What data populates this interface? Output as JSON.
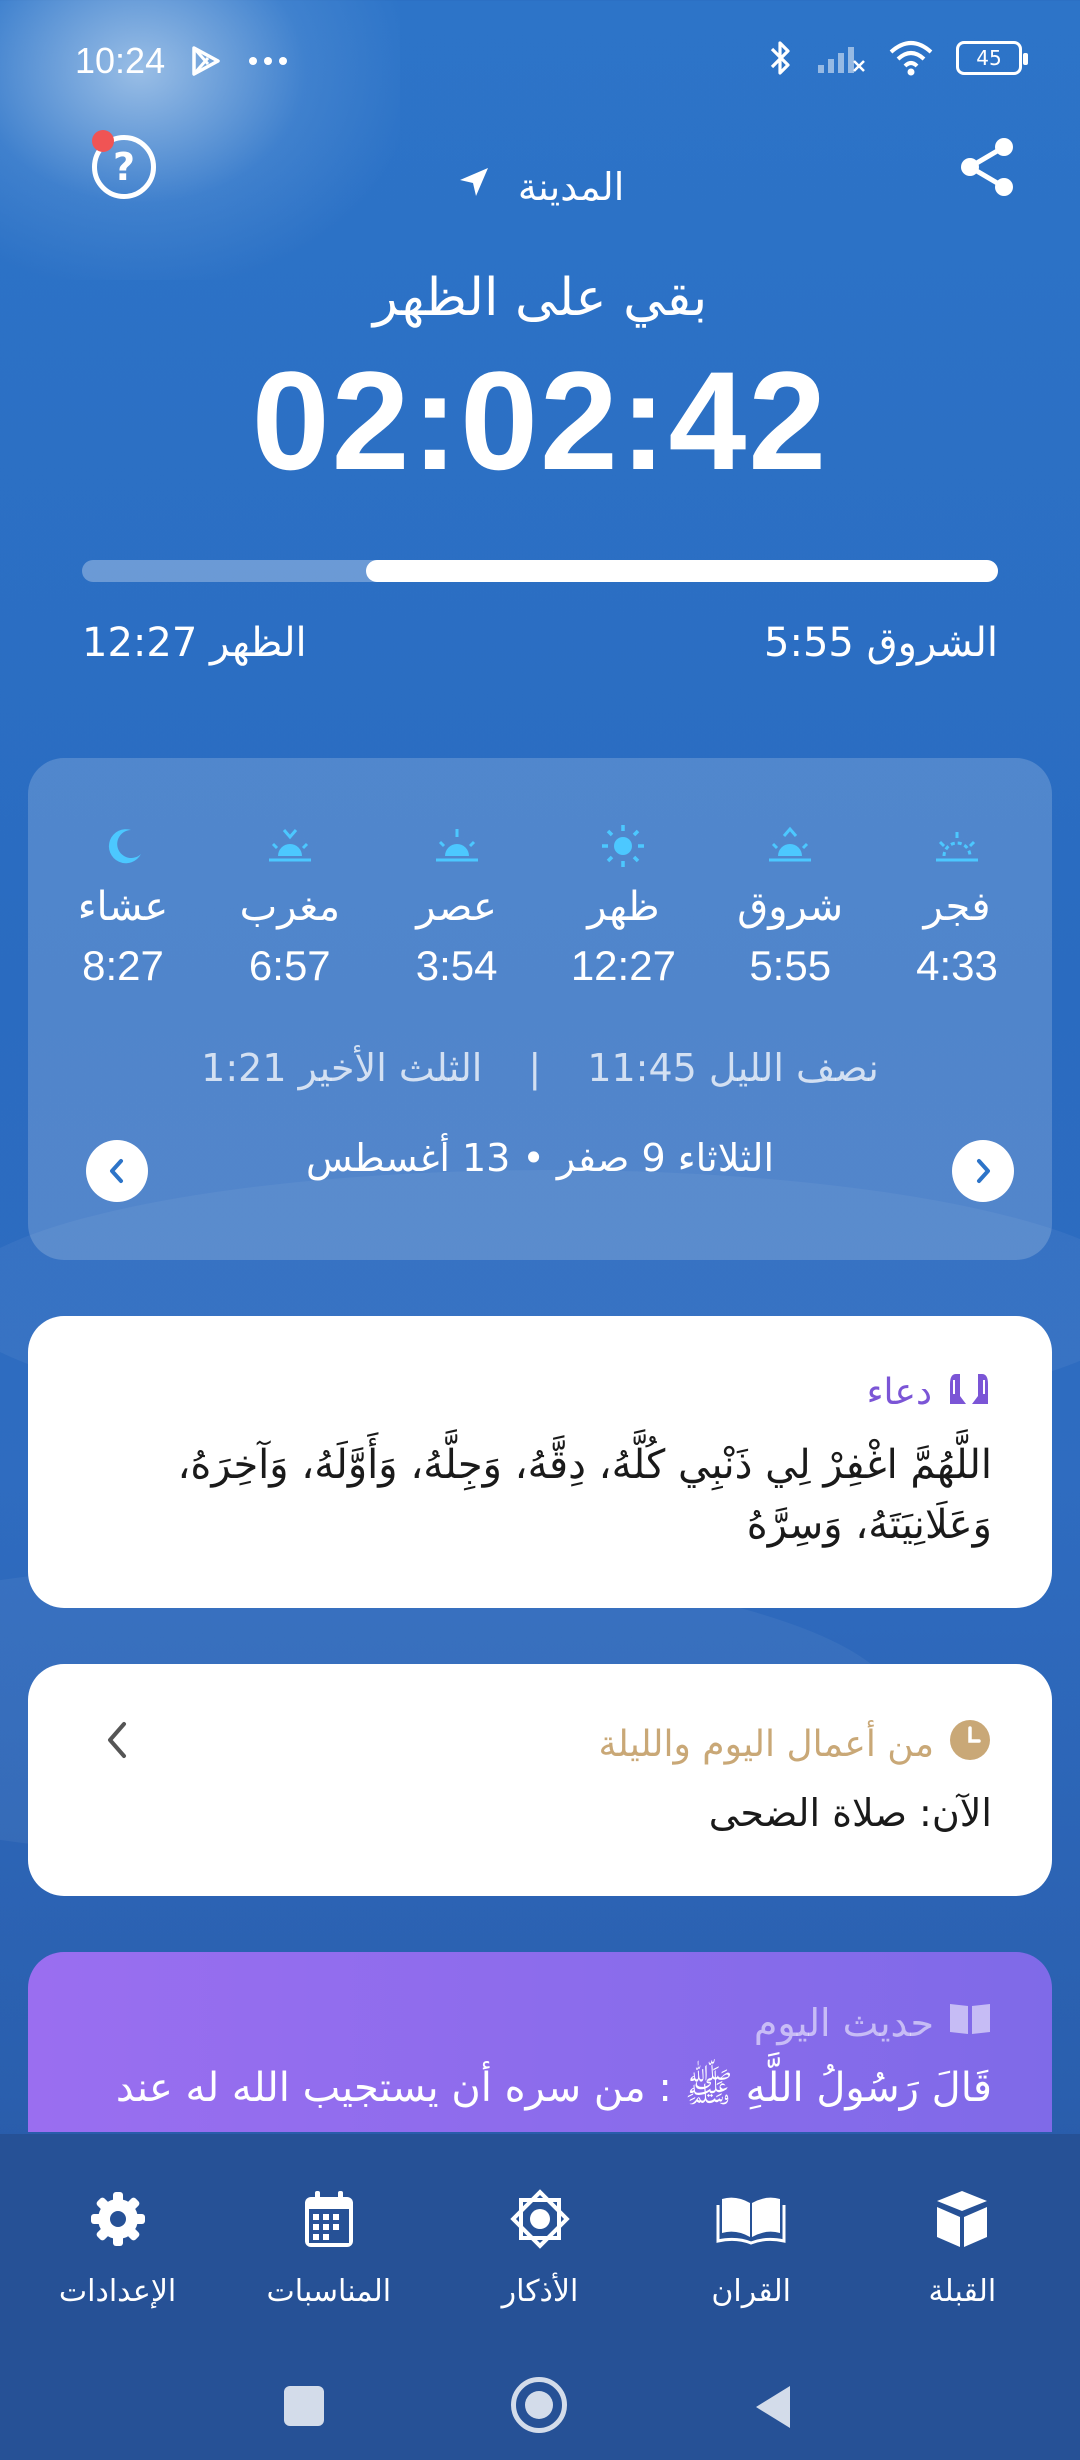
{
  "status_bar": {
    "time": "10:24",
    "battery": "45"
  },
  "header": {
    "city": "المدينة",
    "remaining_label": "بقي على الظهر",
    "countdown": "02:02:42",
    "progress": 0.69,
    "prev_prayer": "الشروق 5:55",
    "next_prayer": "الظهر 12:27"
  },
  "prayers": [
    {
      "name": "فجر",
      "time": "4:33",
      "icon": "dawn-icon"
    },
    {
      "name": "شروق",
      "time": "5:55",
      "icon": "sunrise-icon"
    },
    {
      "name": "ظهر",
      "time": "12:27",
      "icon": "sun-icon"
    },
    {
      "name": "عصر",
      "time": "3:54",
      "icon": "afternoon-sun-icon"
    },
    {
      "name": "مغرب",
      "time": "6:57",
      "icon": "sunset-icon"
    },
    {
      "name": "عشاء",
      "time": "8:27",
      "icon": "moon-icon"
    }
  ],
  "night": {
    "midnight": "نصف الليل 11:45",
    "last_third": "الثلث الأخير 1:21"
  },
  "date": {
    "text": "الثلاثاء  9 صفر • 13 أغسطس"
  },
  "dua": {
    "title": "دعاء",
    "text": "اللَّهُمَّ اغْفِرْ لِي ذَنْبِي كُلَّهُ، دِقَّهُ، وَجِلَّهُ، وَأَوَّلَهُ، وَآخِرَهُ، وَعَلَانِيَتَهُ، وَسِرَّهُ"
  },
  "deeds": {
    "title": "من أعمال اليوم والليلة",
    "now": "الآن: صلاة الضحى"
  },
  "hadith": {
    "title": "حديث اليوم",
    "text": "قَالَ رَسُولُ اللَّهِ ﷺ : من سره أن يستجيب الله له عند"
  },
  "tabs": [
    {
      "label": "القبلة",
      "icon": "kaaba-icon"
    },
    {
      "label": "القران",
      "icon": "quran-book-icon"
    },
    {
      "label": "الأذكار",
      "icon": "adhkar-star-icon"
    },
    {
      "label": "المناسبات",
      "icon": "calendar-icon"
    },
    {
      "label": "الإعدادات",
      "icon": "settings-gear-icon"
    }
  ],
  "colors": {
    "accent_cyan": "#4cc8ff",
    "dua_purple": "#7b55d6",
    "deeds_gold": "#c9a877",
    "hadith_purple": "#8d6cee"
  }
}
